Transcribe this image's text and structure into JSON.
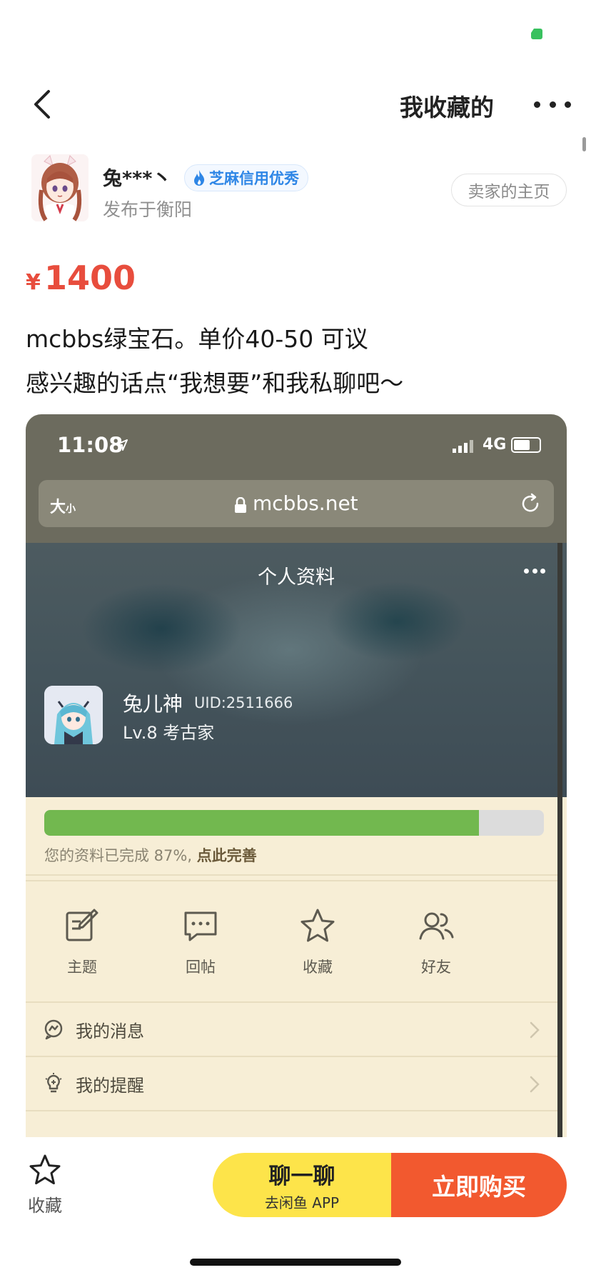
{
  "colors": {
    "price": "#e84d3d",
    "chat_button": "#fde44a",
    "buy_button": "#f2592f",
    "credit_badge": "#2e86e6",
    "progress_fill": "#72b84f"
  },
  "header": {
    "title": "我收藏的",
    "back_icon": "chevron-left-icon",
    "more_icon": "more-dots-icon"
  },
  "seller": {
    "name": "兔***丶",
    "credit_badge": "芝麻信用优秀",
    "location": "发布于衡阳",
    "home_button": "卖家的主页"
  },
  "item": {
    "currency": "¥",
    "price": "1400",
    "description_line1": "mcbbs绿宝石。单价40-50 可议",
    "description_line2": "感兴趣的话点“我想要”和我私聊吧～"
  },
  "screenshot": {
    "status": {
      "time": "11:08",
      "network": "4G"
    },
    "address_bar": {
      "text_size": "大",
      "text_size_small": "小",
      "url": "mcbbs.net"
    },
    "profile": {
      "title": "个人资料",
      "user_name": "兔儿神",
      "uid": "UID:2511666",
      "level": "Lv.8 考古家"
    },
    "completion": {
      "percent": 0.87,
      "text": "您的资料已完成 87%, ",
      "link": "点此完善"
    },
    "quick_actions": [
      {
        "label": "主题",
        "icon": "edit-icon"
      },
      {
        "label": "回帖",
        "icon": "comment-icon"
      },
      {
        "label": "收藏",
        "icon": "star-icon"
      },
      {
        "label": "好友",
        "icon": "friends-icon"
      }
    ],
    "menu": [
      {
        "label": "我的消息",
        "icon": "message-icon"
      },
      {
        "label": "我的提醒",
        "icon": "bulb-icon"
      }
    ]
  },
  "bottom_bar": {
    "favorite_label": "收藏",
    "chat_label": "聊一聊",
    "chat_sub": "去闲鱼 APP",
    "buy_label": "立即购买"
  }
}
